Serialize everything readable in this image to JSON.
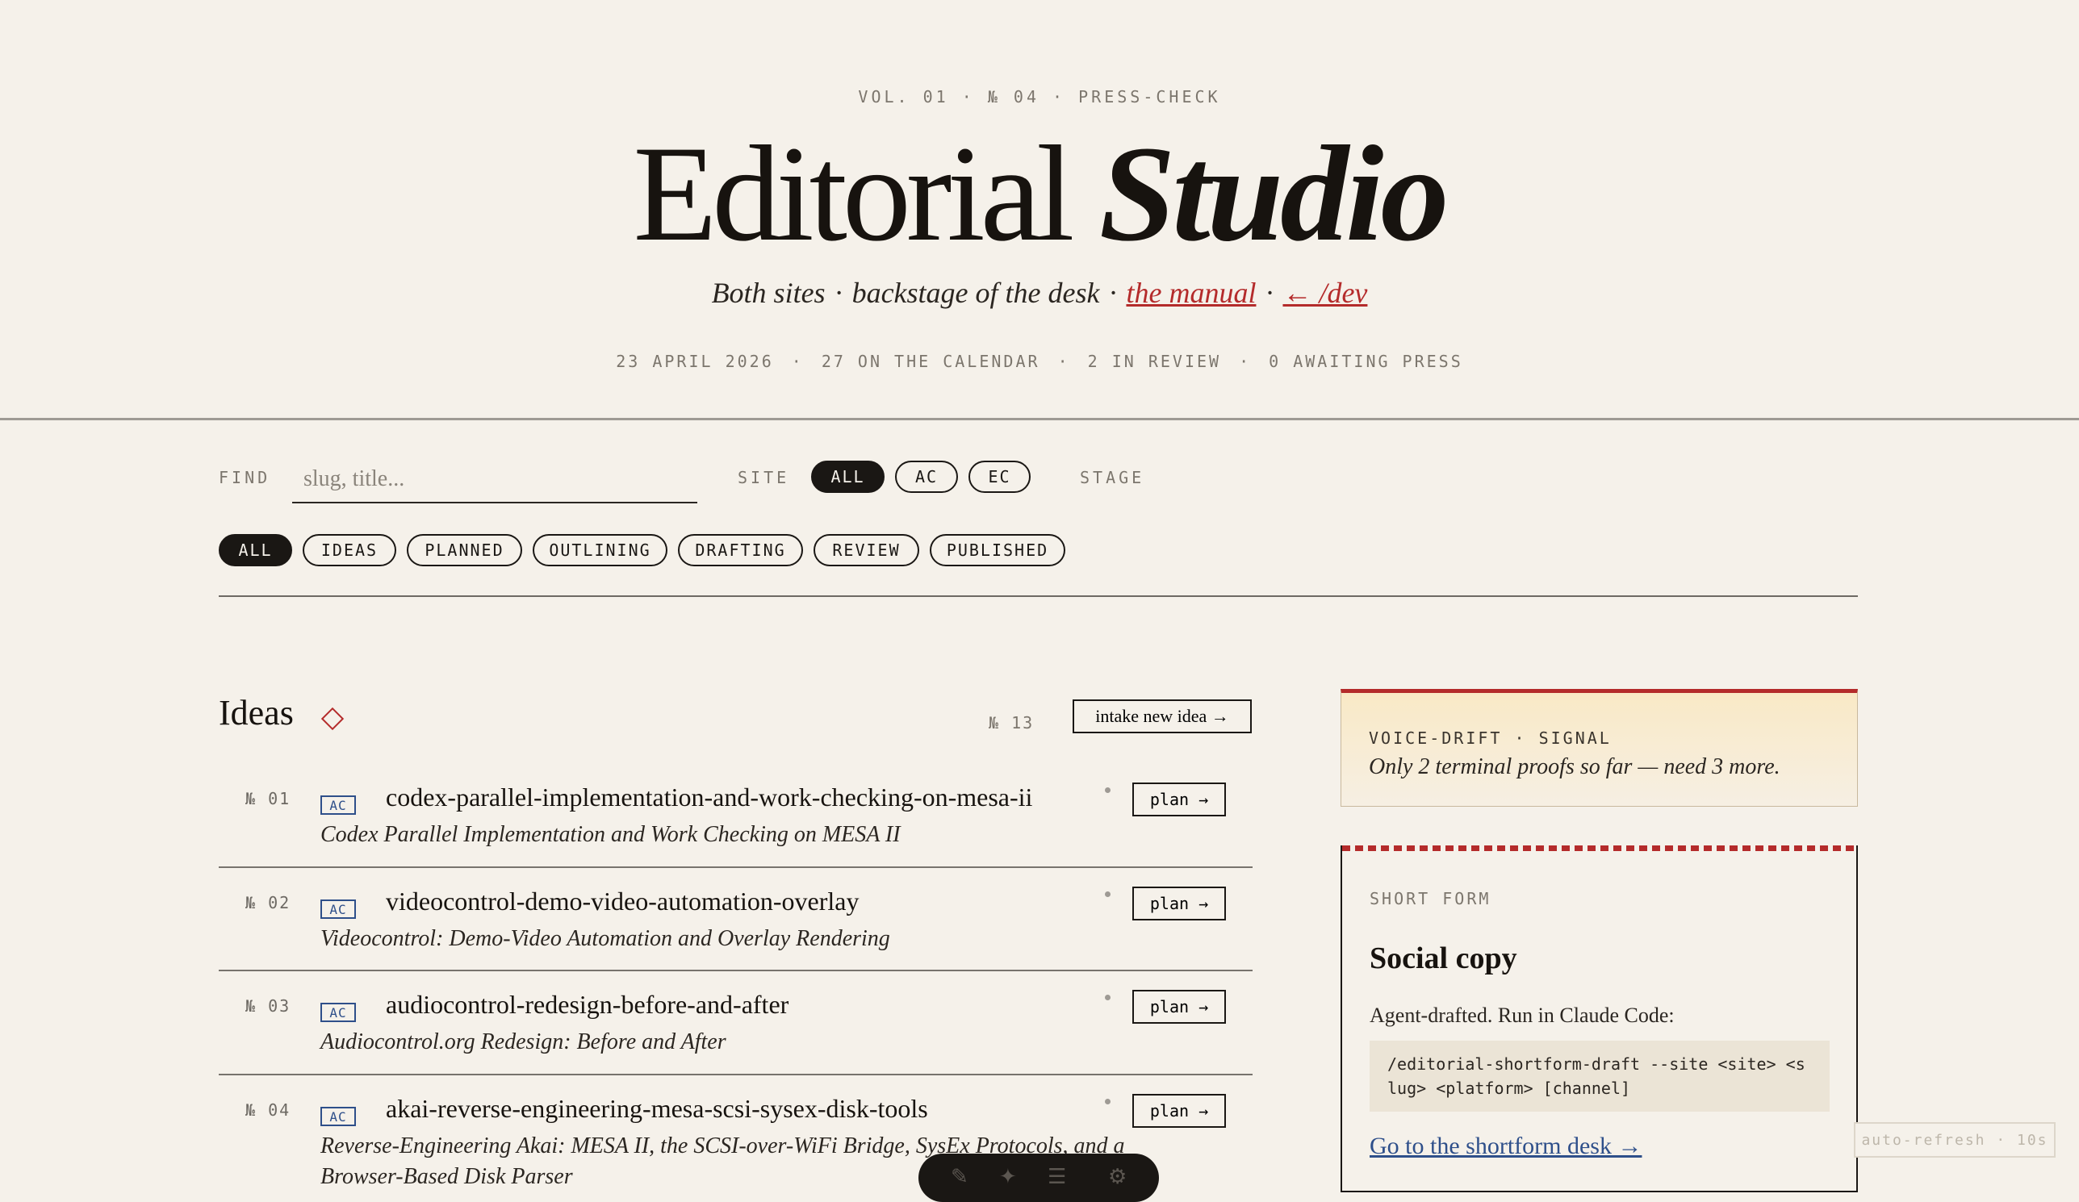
{
  "masthead": {
    "kicker": "VOL. 01 · № 04 · PRESS-CHECK",
    "title_main": "Editorial",
    "title_italic": "Studio",
    "tagline_1": "Both sites",
    "tagline_2": "backstage of the desk",
    "tagline_link_manual": "the manual",
    "tagline_link_dev": "← /dev",
    "stats": [
      "23 APRIL 2026",
      "27 ON THE CALENDAR",
      "2 IN REVIEW",
      "0 AWAITING PRESS"
    ]
  },
  "filters": {
    "find_label": "FIND",
    "find_placeholder": "slug, title...",
    "site_label": "SITE",
    "site_options": [
      "ALL",
      "AC",
      "EC"
    ],
    "stage_label": "STAGE",
    "stage_options": [
      "ALL",
      "IDEAS",
      "PLANNED",
      "OUTLINING",
      "DRAFTING",
      "REVIEW",
      "PUBLISHED"
    ]
  },
  "ideas": {
    "title": "Ideas",
    "count": "№ 13",
    "intake_label": "intake new idea →",
    "items": [
      {
        "num": "№ 01",
        "site": "AC",
        "slug": "codex-parallel-implementation-and-work-checking-on-mesa-ii",
        "subtitle": "Codex Parallel Implementation and Work Checking on MESA II",
        "action": "plan →"
      },
      {
        "num": "№ 02",
        "site": "AC",
        "slug": "videocontrol-demo-video-automation-overlay",
        "subtitle": "Videocontrol: Demo-Video Automation and Overlay Rendering",
        "action": "plan →"
      },
      {
        "num": "№ 03",
        "site": "AC",
        "slug": "audiocontrol-redesign-before-and-after",
        "subtitle": "Audiocontrol.org Redesign: Before and After",
        "action": "plan →"
      },
      {
        "num": "№ 04",
        "site": "AC",
        "slug": "akai-reverse-engineering-mesa-scsi-sysex-disk-tools",
        "subtitle": "Reverse-Engineering Akai: MESA II, the SCSI-over-WiFi Bridge, SysEx Protocols, and a Browser-Based Disk Parser",
        "action": "plan →"
      }
    ]
  },
  "voice_drift": {
    "kicker": "VOICE-DRIFT · SIGNAL",
    "message": "Only 2 terminal proofs so far — need 3 more."
  },
  "short_form": {
    "kicker": "SHORT FORM",
    "title": "Social copy",
    "text": "Agent-drafted. Run in Claude Code:",
    "command": "/editorial-shortform-draft --site <site> <slug> <platform> [channel]",
    "link": "Go to the shortform desk →"
  },
  "auto_refresh": "auto-refresh · 10s",
  "colors": {
    "accent_red": "#b42b2b",
    "link_blue": "#2e4f8a",
    "paper": "#f5f1ea",
    "ink": "#1a1714"
  }
}
